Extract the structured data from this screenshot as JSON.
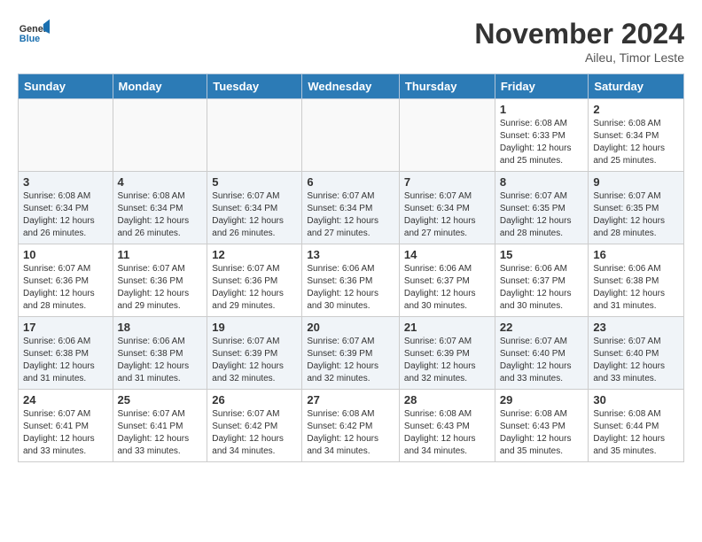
{
  "header": {
    "logo_line1": "General",
    "logo_line2": "Blue",
    "month_title": "November 2024",
    "location": "Aileu, Timor Leste"
  },
  "weekdays": [
    "Sunday",
    "Monday",
    "Tuesday",
    "Wednesday",
    "Thursday",
    "Friday",
    "Saturday"
  ],
  "weeks": [
    [
      {
        "day": "",
        "info": ""
      },
      {
        "day": "",
        "info": ""
      },
      {
        "day": "",
        "info": ""
      },
      {
        "day": "",
        "info": ""
      },
      {
        "day": "",
        "info": ""
      },
      {
        "day": "1",
        "info": "Sunrise: 6:08 AM\nSunset: 6:33 PM\nDaylight: 12 hours and 25 minutes."
      },
      {
        "day": "2",
        "info": "Sunrise: 6:08 AM\nSunset: 6:34 PM\nDaylight: 12 hours and 25 minutes."
      }
    ],
    [
      {
        "day": "3",
        "info": "Sunrise: 6:08 AM\nSunset: 6:34 PM\nDaylight: 12 hours and 26 minutes."
      },
      {
        "day": "4",
        "info": "Sunrise: 6:08 AM\nSunset: 6:34 PM\nDaylight: 12 hours and 26 minutes."
      },
      {
        "day": "5",
        "info": "Sunrise: 6:07 AM\nSunset: 6:34 PM\nDaylight: 12 hours and 26 minutes."
      },
      {
        "day": "6",
        "info": "Sunrise: 6:07 AM\nSunset: 6:34 PM\nDaylight: 12 hours and 27 minutes."
      },
      {
        "day": "7",
        "info": "Sunrise: 6:07 AM\nSunset: 6:34 PM\nDaylight: 12 hours and 27 minutes."
      },
      {
        "day": "8",
        "info": "Sunrise: 6:07 AM\nSunset: 6:35 PM\nDaylight: 12 hours and 28 minutes."
      },
      {
        "day": "9",
        "info": "Sunrise: 6:07 AM\nSunset: 6:35 PM\nDaylight: 12 hours and 28 minutes."
      }
    ],
    [
      {
        "day": "10",
        "info": "Sunrise: 6:07 AM\nSunset: 6:36 PM\nDaylight: 12 hours and 28 minutes."
      },
      {
        "day": "11",
        "info": "Sunrise: 6:07 AM\nSunset: 6:36 PM\nDaylight: 12 hours and 29 minutes."
      },
      {
        "day": "12",
        "info": "Sunrise: 6:07 AM\nSunset: 6:36 PM\nDaylight: 12 hours and 29 minutes."
      },
      {
        "day": "13",
        "info": "Sunrise: 6:06 AM\nSunset: 6:36 PM\nDaylight: 12 hours and 30 minutes."
      },
      {
        "day": "14",
        "info": "Sunrise: 6:06 AM\nSunset: 6:37 PM\nDaylight: 12 hours and 30 minutes."
      },
      {
        "day": "15",
        "info": "Sunrise: 6:06 AM\nSunset: 6:37 PM\nDaylight: 12 hours and 30 minutes."
      },
      {
        "day": "16",
        "info": "Sunrise: 6:06 AM\nSunset: 6:38 PM\nDaylight: 12 hours and 31 minutes."
      }
    ],
    [
      {
        "day": "17",
        "info": "Sunrise: 6:06 AM\nSunset: 6:38 PM\nDaylight: 12 hours and 31 minutes."
      },
      {
        "day": "18",
        "info": "Sunrise: 6:06 AM\nSunset: 6:38 PM\nDaylight: 12 hours and 31 minutes."
      },
      {
        "day": "19",
        "info": "Sunrise: 6:07 AM\nSunset: 6:39 PM\nDaylight: 12 hours and 32 minutes."
      },
      {
        "day": "20",
        "info": "Sunrise: 6:07 AM\nSunset: 6:39 PM\nDaylight: 12 hours and 32 minutes."
      },
      {
        "day": "21",
        "info": "Sunrise: 6:07 AM\nSunset: 6:39 PM\nDaylight: 12 hours and 32 minutes."
      },
      {
        "day": "22",
        "info": "Sunrise: 6:07 AM\nSunset: 6:40 PM\nDaylight: 12 hours and 33 minutes."
      },
      {
        "day": "23",
        "info": "Sunrise: 6:07 AM\nSunset: 6:40 PM\nDaylight: 12 hours and 33 minutes."
      }
    ],
    [
      {
        "day": "24",
        "info": "Sunrise: 6:07 AM\nSunset: 6:41 PM\nDaylight: 12 hours and 33 minutes."
      },
      {
        "day": "25",
        "info": "Sunrise: 6:07 AM\nSunset: 6:41 PM\nDaylight: 12 hours and 33 minutes."
      },
      {
        "day": "26",
        "info": "Sunrise: 6:07 AM\nSunset: 6:42 PM\nDaylight: 12 hours and 34 minutes."
      },
      {
        "day": "27",
        "info": "Sunrise: 6:08 AM\nSunset: 6:42 PM\nDaylight: 12 hours and 34 minutes."
      },
      {
        "day": "28",
        "info": "Sunrise: 6:08 AM\nSunset: 6:43 PM\nDaylight: 12 hours and 34 minutes."
      },
      {
        "day": "29",
        "info": "Sunrise: 6:08 AM\nSunset: 6:43 PM\nDaylight: 12 hours and 35 minutes."
      },
      {
        "day": "30",
        "info": "Sunrise: 6:08 AM\nSunset: 6:44 PM\nDaylight: 12 hours and 35 minutes."
      }
    ]
  ]
}
